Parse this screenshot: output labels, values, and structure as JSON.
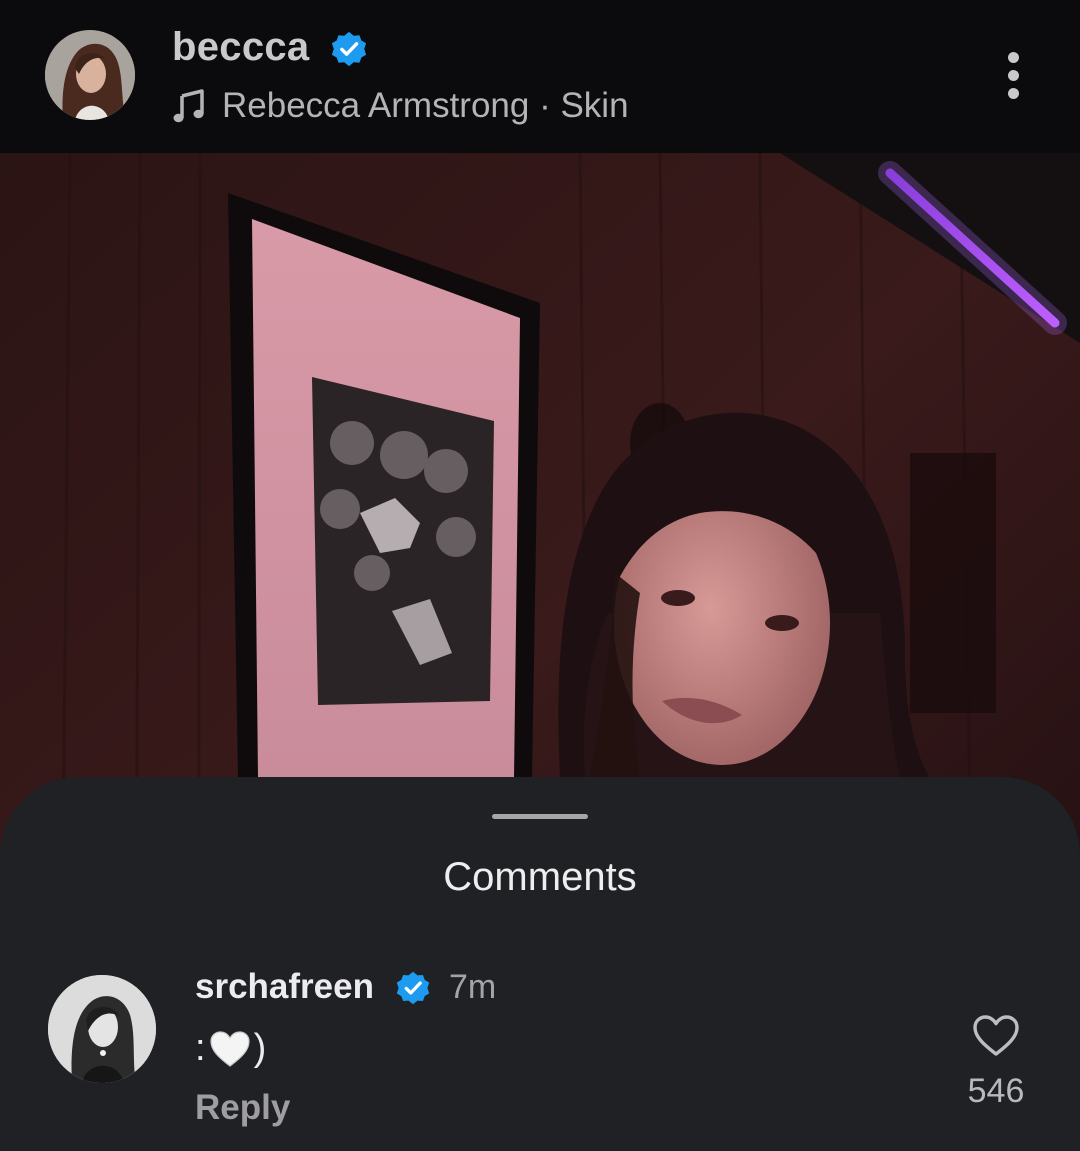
{
  "header": {
    "username": "beccca",
    "verified": true,
    "music_label": "Rebecca Armstrong · Skin",
    "music_icon": "music-note-icon",
    "more_icon": "more-vertical-icon"
  },
  "colors": {
    "verified_blue": "#1d9bf0",
    "background": "#0b0b0d",
    "sheet": "#202125"
  },
  "comments_sheet": {
    "title": "Comments",
    "comments": [
      {
        "username": "srchafreen",
        "verified": true,
        "time": "7m",
        "text_prefix": ":",
        "text_emoji": "white-heart-emoji",
        "text_suffix": ")",
        "reply_label": "Reply",
        "like_count": "546",
        "like_icon": "heart-outline-icon"
      }
    ]
  }
}
